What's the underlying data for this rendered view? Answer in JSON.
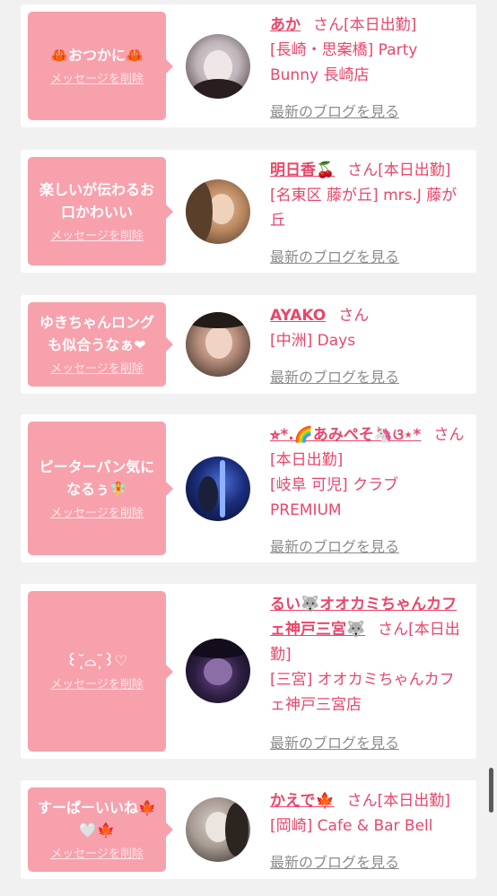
{
  "delete_label": "メッセージを削除",
  "san_label": "さん",
  "blog_label": "最新のブログを見る",
  "items": [
    {
      "message": "🦀おつかに🦀",
      "name": "あか",
      "status": "[本日出勤]",
      "shop": "[長崎・思案橋] Party Bunny 長崎店"
    },
    {
      "message": "楽しいが伝わるお口かわいい",
      "name": "明日香🍒",
      "status": "[本日出勤]",
      "shop": "[名東区 藤が丘] mrs.J 藤が丘"
    },
    {
      "message": "ゆきちゃんロングも似合うなぁ❤",
      "name": "AYAKO",
      "status": "",
      "shop": "[中洲] Days"
    },
    {
      "message": "ピーターパン気になるぅ🧚",
      "name": "⭐︎*.🌈あみぺそ🦄ଓ⋆*",
      "status": "[本日出勤]",
      "shop": "[岐阜 可児] クラブPREMIUM"
    },
    {
      "message": "꒰˘̩̩̩⌓˘̩̩̩꒱♡",
      "name": "るい🐺オオカミちゃんカフェ神戸三宮🐺",
      "status": "[本日出勤]",
      "shop": "[三宮] オオカミちゃんカフェ神戸三宮店"
    },
    {
      "message": "すーぱーいいね🍁🤍🍁",
      "name": "かえで🍁",
      "status": "[本日出勤]",
      "shop": "[岡崎] Cafe & Bar Bell"
    }
  ]
}
